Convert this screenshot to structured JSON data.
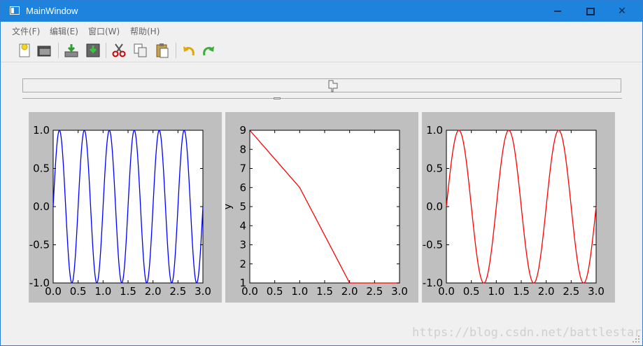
{
  "window": {
    "title": "MainWindow"
  },
  "menubar": {
    "items": [
      {
        "label": "文件(F)"
      },
      {
        "label": "编辑(E)"
      },
      {
        "label": "窗口(W)"
      },
      {
        "label": "帮助(H)"
      }
    ]
  },
  "toolbar": {
    "icons": [
      "new-file-icon",
      "open-folder-icon",
      "download-icon",
      "save-icon",
      "cut-icon",
      "copy-icon",
      "paste-icon",
      "undo-icon",
      "redo-icon"
    ]
  },
  "watermark": "https://blog.csdn.net/battlestar",
  "colors": {
    "titlebar": "#1e83dc",
    "blue_line": "#0000ff",
    "red_line": "#ff0000",
    "figure_bg": "#bfbfbf"
  },
  "chart_data": [
    {
      "type": "line",
      "title": "",
      "xlabel": "",
      "ylabel": "",
      "xlim": [
        0,
        3.0
      ],
      "ylim": [
        -1.0,
        1.0
      ],
      "xticks": [
        "0.0",
        "0.5",
        "1.0",
        "1.5",
        "2.0",
        "2.5",
        "3.0"
      ],
      "yticks": [
        "-1.0",
        "-0.5",
        "0.0",
        "0.5",
        "1.0"
      ],
      "function": "sin(2*pi*2*x)",
      "x": [
        0.0,
        0.125,
        0.25,
        0.375,
        0.5,
        0.625,
        0.75,
        0.875,
        1.0,
        1.125,
        1.25,
        1.375,
        1.5,
        1.625,
        1.75,
        1.875,
        2.0,
        2.125,
        2.25,
        2.375,
        2.5,
        2.625,
        2.75,
        2.875,
        3.0
      ],
      "y": [
        0.0,
        1.0,
        0.0,
        -1.0,
        0.0,
        1.0,
        0.0,
        -1.0,
        0.0,
        1.0,
        0.0,
        -1.0,
        0.0,
        1.0,
        0.0,
        -1.0,
        0.0,
        1.0,
        0.0,
        -1.0,
        0.0,
        1.0,
        0.0,
        -1.0,
        0.0
      ],
      "color": "#0000ff"
    },
    {
      "type": "line",
      "title": "",
      "xlabel": "",
      "ylabel": "y",
      "xlim": [
        0,
        3.0
      ],
      "ylim": [
        1,
        9
      ],
      "xticks": [
        "0.0",
        "0.5",
        "1.0",
        "1.5",
        "2.0",
        "2.5",
        "3.0"
      ],
      "yticks": [
        "1",
        "2",
        "3",
        "4",
        "5",
        "6",
        "7",
        "8",
        "9"
      ],
      "x": [
        0,
        1,
        2,
        3
      ],
      "y": [
        9,
        6,
        1,
        1
      ],
      "color": "#ff0000"
    },
    {
      "type": "line",
      "title": "",
      "xlabel": "",
      "ylabel": "",
      "xlim": [
        0,
        3.0
      ],
      "ylim": [
        -1.0,
        1.0
      ],
      "xticks": [
        "0.0",
        "0.5",
        "1.0",
        "1.5",
        "2.0",
        "2.5",
        "3.0"
      ],
      "yticks": [
        "-1.0",
        "-0.5",
        "0.0",
        "0.5",
        "1.0"
      ],
      "function": "sin(2*pi*x)",
      "x": [
        0.0,
        0.25,
        0.5,
        0.75,
        1.0,
        1.25,
        1.5,
        1.75,
        2.0,
        2.25,
        2.5,
        2.75,
        3.0
      ],
      "y": [
        0.0,
        1.0,
        0.0,
        -1.0,
        0.0,
        1.0,
        0.0,
        -1.0,
        0.0,
        1.0,
        0.0,
        -1.0,
        0.0
      ],
      "color": "#ff0000"
    }
  ]
}
